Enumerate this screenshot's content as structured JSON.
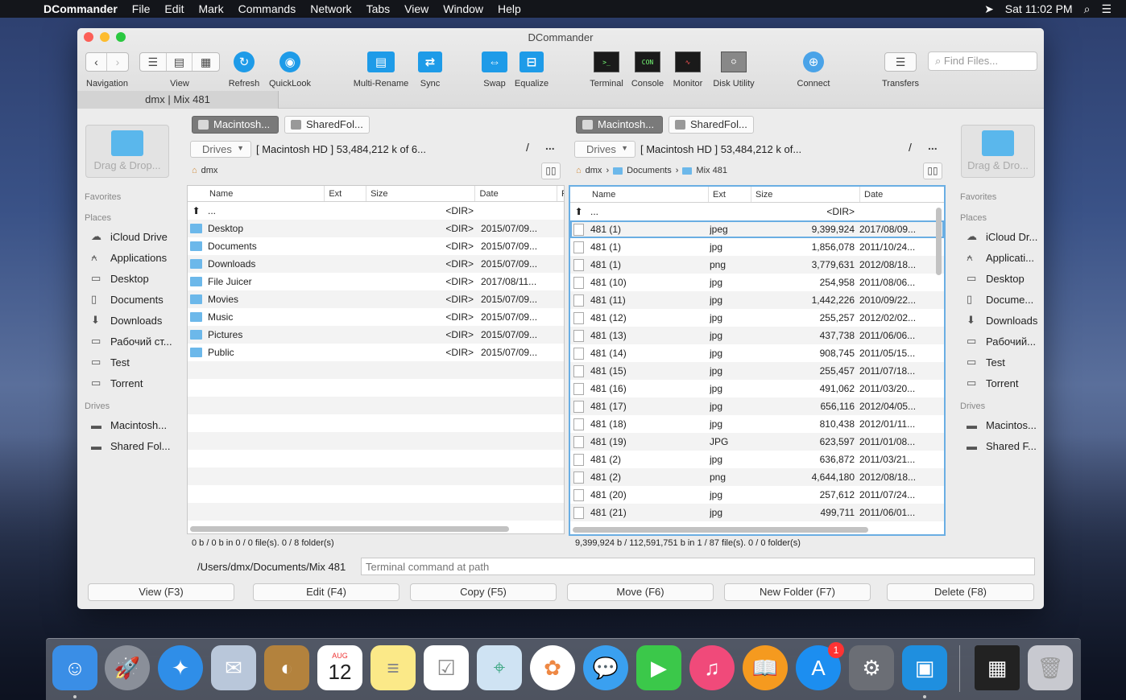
{
  "menubar": {
    "app": "DCommander",
    "items": [
      "File",
      "Edit",
      "Mark",
      "Commands",
      "Network",
      "Tabs",
      "View",
      "Window",
      "Help"
    ],
    "clock": "Sat 11:02 PM"
  },
  "window": {
    "title": "DCommander",
    "tab": "dmx | Mix 481"
  },
  "toolbar": {
    "navigation": "Navigation",
    "view": "View",
    "refresh": "Refresh",
    "quicklook": "QuickLook",
    "multirename": "Multi-Rename",
    "sync": "Sync",
    "swap": "Swap",
    "equalize": "Equalize",
    "terminal": "Terminal",
    "console": "Console",
    "monitor": "Monitor",
    "diskutility": "Disk Utility",
    "connect": "Connect",
    "transfers": "Transfers",
    "find_placeholder": "Find Files..."
  },
  "sidebar_left": {
    "drop": "Drag & Drop...",
    "favorites": "Favorites",
    "places": "Places",
    "places_items": [
      "iCloud Drive",
      "Applications",
      "Desktop",
      "Documents",
      "Downloads",
      "Рабочий ст...",
      "Test",
      "Torrent"
    ],
    "drives": "Drives",
    "drive_items": [
      "Macintosh...",
      "Shared Fol..."
    ]
  },
  "sidebar_right": {
    "drop": "Drag & Dro...",
    "favorites": "Favorites",
    "places": "Places",
    "places_items": [
      "iCloud Dr...",
      "Applicati...",
      "Desktop",
      "Docume...",
      "Downloads",
      "Рабочий...",
      "Test",
      "Torrent"
    ],
    "drives": "Drives",
    "drive_items": [
      "Macintos...",
      "Shared F..."
    ]
  },
  "left_panel": {
    "tab1": "Macintosh...",
    "tab2": "SharedFol...",
    "drives": "Drives",
    "info": "[ Macintosh HD ]  53,484,212 k of 6...",
    "root": "/",
    "more": "...",
    "crumb": "dmx",
    "headers": {
      "name": "Name",
      "ext": "Ext",
      "size": "Size",
      "date": "Date"
    },
    "rows": [
      {
        "name": "...",
        "size": "<DIR>",
        "date": ""
      },
      {
        "name": "Desktop",
        "size": "<DIR>",
        "date": "2015/07/09..."
      },
      {
        "name": "Documents",
        "size": "<DIR>",
        "date": "2015/07/09..."
      },
      {
        "name": "Downloads",
        "size": "<DIR>",
        "date": "2015/07/09..."
      },
      {
        "name": "File Juicer",
        "size": "<DIR>",
        "date": "2017/08/11..."
      },
      {
        "name": "Movies",
        "size": "<DIR>",
        "date": "2015/07/09..."
      },
      {
        "name": "Music",
        "size": "<DIR>",
        "date": "2015/07/09..."
      },
      {
        "name": "Pictures",
        "size": "<DIR>",
        "date": "2015/07/09..."
      },
      {
        "name": "Public",
        "size": "<DIR>",
        "date": "2015/07/09..."
      }
    ],
    "status": "0 b / 0 b in 0 / 0 file(s).   0 / 8 folder(s)"
  },
  "right_panel": {
    "tab1": "Macintosh...",
    "tab2": "SharedFol...",
    "drives": "Drives",
    "info": "[ Macintosh HD ]  53,484,212 k of...",
    "root": "/",
    "more": "...",
    "crumbs": [
      "dmx",
      "Documents",
      "Mix 481"
    ],
    "headers": {
      "name": "Name",
      "ext": "Ext",
      "size": "Size",
      "date": "Date"
    },
    "rows": [
      {
        "name": "...",
        "ext": "",
        "size": "<DIR>",
        "date": ""
      },
      {
        "name": "481 (1)",
        "ext": "jpeg",
        "size": "9,399,924",
        "date": "2017/08/09..."
      },
      {
        "name": "481 (1)",
        "ext": "jpg",
        "size": "1,856,078",
        "date": "2011/10/24..."
      },
      {
        "name": "481 (1)",
        "ext": "png",
        "size": "3,779,631",
        "date": "2012/08/18..."
      },
      {
        "name": "481 (10)",
        "ext": "jpg",
        "size": "254,958",
        "date": "2011/08/06..."
      },
      {
        "name": "481 (11)",
        "ext": "jpg",
        "size": "1,442,226",
        "date": "2010/09/22..."
      },
      {
        "name": "481 (12)",
        "ext": "jpg",
        "size": "255,257",
        "date": "2012/02/02..."
      },
      {
        "name": "481 (13)",
        "ext": "jpg",
        "size": "437,738",
        "date": "2011/06/06..."
      },
      {
        "name": "481 (14)",
        "ext": "jpg",
        "size": "908,745",
        "date": "2011/05/15..."
      },
      {
        "name": "481 (15)",
        "ext": "jpg",
        "size": "255,457",
        "date": "2011/07/18..."
      },
      {
        "name": "481 (16)",
        "ext": "jpg",
        "size": "491,062",
        "date": "2011/03/20..."
      },
      {
        "name": "481 (17)",
        "ext": "jpg",
        "size": "656,116",
        "date": "2012/04/05..."
      },
      {
        "name": "481 (18)",
        "ext": "jpg",
        "size": "810,438",
        "date": "2012/01/11..."
      },
      {
        "name": "481 (19)",
        "ext": "JPG",
        "size": "623,597",
        "date": "2011/01/08..."
      },
      {
        "name": "481 (2)",
        "ext": "jpg",
        "size": "636,872",
        "date": "2011/03/21..."
      },
      {
        "name": "481 (2)",
        "ext": "png",
        "size": "4,644,180",
        "date": "2012/08/18..."
      },
      {
        "name": "481 (20)",
        "ext": "jpg",
        "size": "257,612",
        "date": "2011/07/24..."
      },
      {
        "name": "481 (21)",
        "ext": "jpg",
        "size": "499,711",
        "date": "2011/06/01..."
      }
    ],
    "status": "9,399,924 b / 112,591,751 b in 1 / 87 file(s).   0 / 0 folder(s)"
  },
  "command": {
    "path": "/Users/dmx/Documents/Mix 481",
    "placeholder": "Terminal command at path"
  },
  "fkeys": [
    "View (F3)",
    "Edit (F4)",
    "Copy (F5)",
    "Move (F6)",
    "New Folder (F7)",
    "Delete (F8)"
  ],
  "dock": {
    "calendar_month": "AUG",
    "calendar_day": "12",
    "appstore_badge": "1"
  }
}
